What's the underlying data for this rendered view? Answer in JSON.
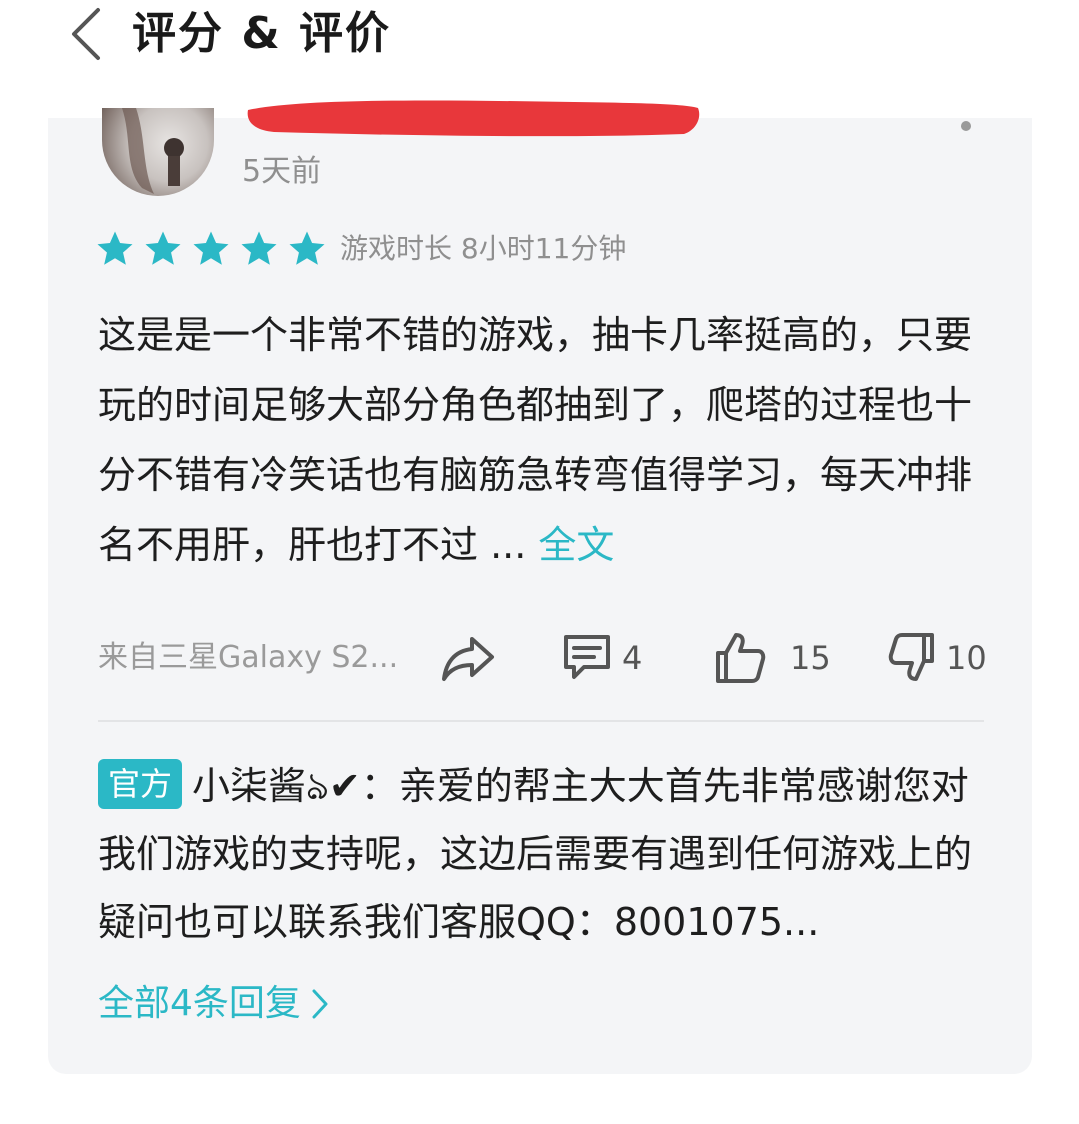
{
  "header": {
    "title": "评分 & 评价"
  },
  "review": {
    "time_ago": "5天前",
    "rating": 5,
    "playtime": "游戏时长 8小时11分钟",
    "text": "这是是一个非常不错的游戏，抽卡几率挺高的，只要玩的时间足够大部分角色都抽到了，爬塔的过程也十分不错有冷笑话也有脑筋急转弯值得学习，每天冲排名不用肝，肝也打不过 ...",
    "expand_label": "全文",
    "device": "来自三星Galaxy S2...",
    "comments": "4",
    "likes": "15",
    "dislikes": "10"
  },
  "official_reply": {
    "badge": "官方",
    "author": "小柒酱ঌ✔",
    "text": "：亲爱的帮主大大首先非常感谢您对我们游戏的支持呢，这边后需要有遇到任何游戏上的疑问也可以联系我们客服QQ：8001075..."
  },
  "all_replies_label": "全部4条回复",
  "colors": {
    "accent": "#2bb8c6",
    "card_bg": "#f4f5f7",
    "redaction": "#e8373b"
  },
  "icons": [
    "back-icon",
    "more-icon",
    "star-icon",
    "share-icon",
    "comment-icon",
    "thumbs-up-icon",
    "thumbs-down-icon",
    "chevron-right-icon"
  ]
}
